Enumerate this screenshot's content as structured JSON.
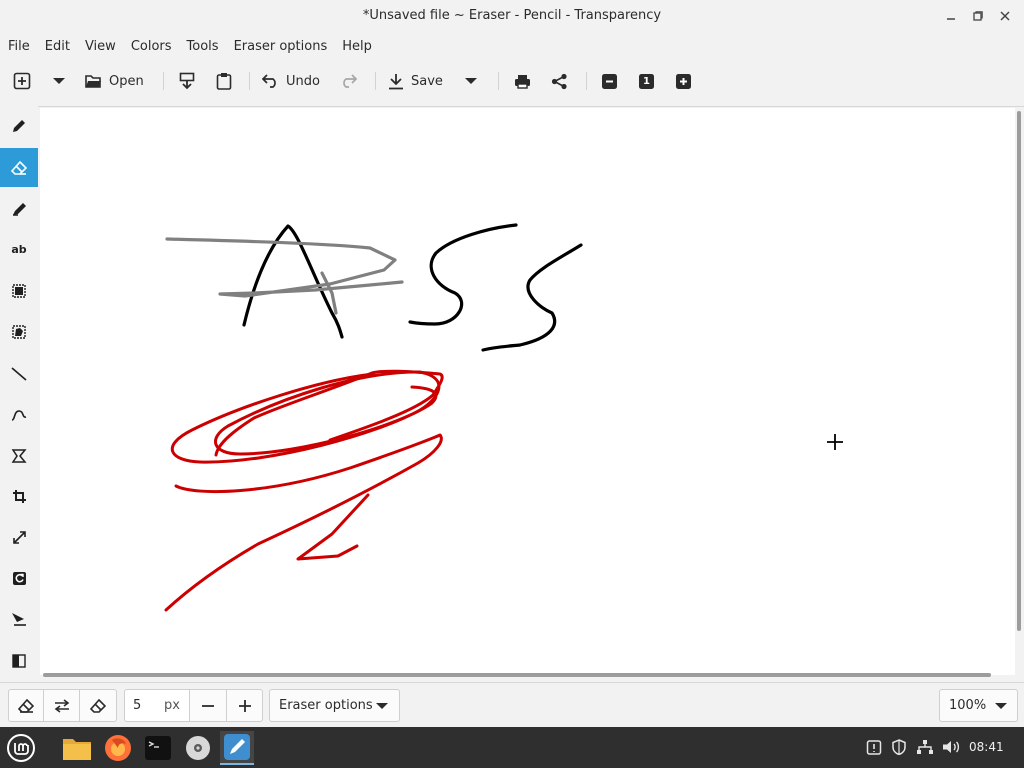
{
  "window": {
    "title": "*Unsaved file ~ Eraser - Pencil - Transparency"
  },
  "menu": [
    "File",
    "Edit",
    "View",
    "Colors",
    "Tools",
    "Eraser options",
    "Help"
  ],
  "toolbar": {
    "open_label": "Open",
    "undo_label": "Undo",
    "save_label": "Save",
    "zoom_out_icon": "minus-icon",
    "zoom_reset_label": "1",
    "zoom_in_icon": "plus-icon"
  },
  "tools": [
    {
      "name": "pencil",
      "icon": "pencil-icon"
    },
    {
      "name": "eraser",
      "icon": "eraser-icon",
      "active": true
    },
    {
      "name": "highlighter",
      "icon": "highlighter-icon"
    },
    {
      "name": "text",
      "label": "ab"
    },
    {
      "name": "rect-selection",
      "icon": "rect-select-icon"
    },
    {
      "name": "free-selection",
      "icon": "free-select-icon"
    },
    {
      "name": "line",
      "icon": "line-icon"
    },
    {
      "name": "curve",
      "icon": "curve-icon"
    },
    {
      "name": "shape",
      "icon": "shape-icon"
    },
    {
      "name": "crop",
      "icon": "crop-icon"
    },
    {
      "name": "scale",
      "icon": "scale-icon"
    },
    {
      "name": "rotate",
      "icon": "rotate-icon"
    },
    {
      "name": "skew",
      "icon": "skew-icon"
    },
    {
      "name": "filters",
      "icon": "filters-icon"
    }
  ],
  "options_bar": {
    "size_value": "5",
    "size_unit": "px",
    "options_label": "Eraser options",
    "zoom_value": "100%"
  },
  "taskbar": {
    "clock": "08:41"
  },
  "colors": {
    "accent": "#2d9bd7",
    "stroke_black": "#000000",
    "stroke_gray": "#808080",
    "stroke_red": "#cc0000"
  }
}
